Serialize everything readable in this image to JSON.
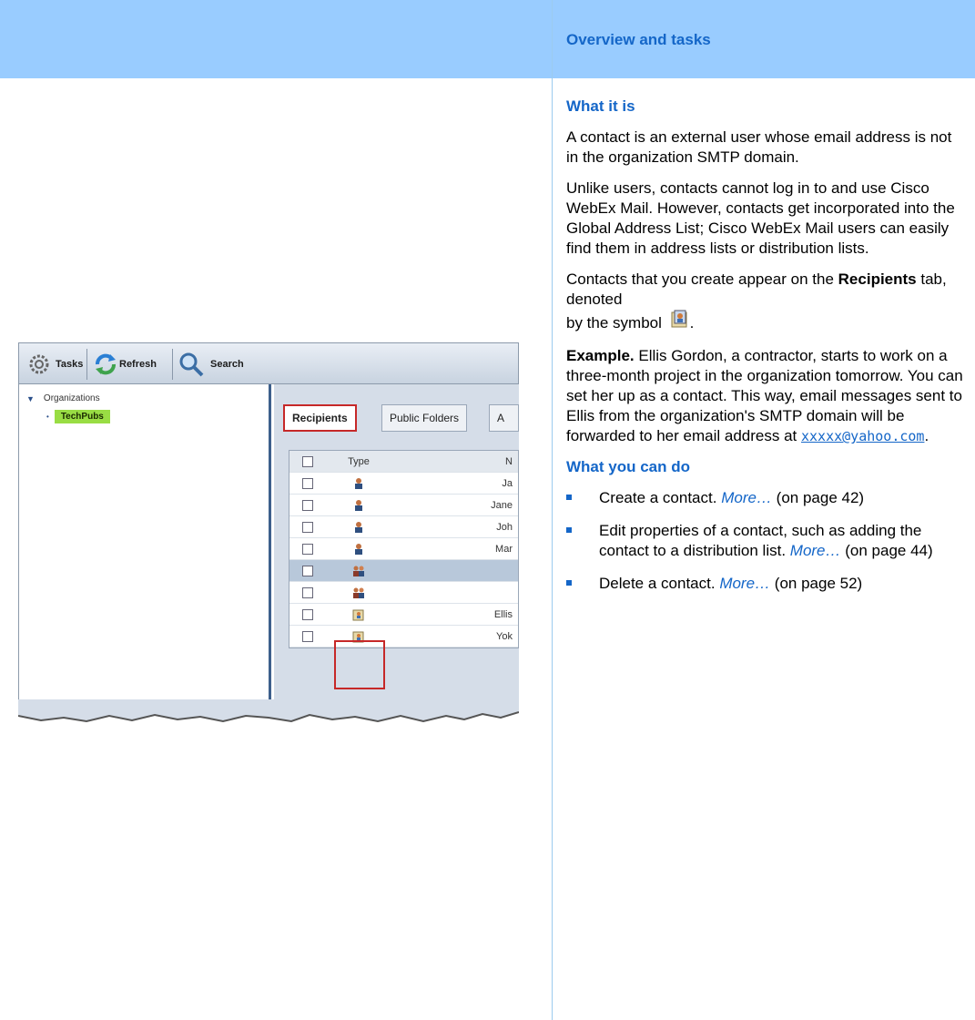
{
  "header": {
    "title": "Overview and tasks"
  },
  "what_it_is": {
    "heading": "What it is",
    "p1": "A contact is an external user whose email address is not in the organization SMTP domain.",
    "p2": "Unlike users, contacts cannot log in to and use Cisco WebEx Mail. However, contacts get incorporated into the Global Address List; Cisco WebEx Mail users can easily find them in address lists or distribution lists.",
    "p3_before": "Contacts that you create appear on the",
    "p3_bold": "Recipients",
    "p3_after": "tab, denoted",
    "p3_line2": "by the symbol",
    "example_label": "Example.",
    "example_text": "Ellis Gordon, a contractor, starts to work on a three-month project in the organization tomorrow. You can set her up as a contact. This way, email messages sent to Ellis from the organization's SMTP domain will be forwarded to her email address at",
    "email": "xxxxx@yahoo.com"
  },
  "what_you_can_do": {
    "heading": "What you can do",
    "items": [
      {
        "text": "Create a contact.",
        "more": "More…",
        "page": "(on page 42)"
      },
      {
        "text": "Edit properties of a contact, such as adding the contact to a distribution list.",
        "more": "More…",
        "page": "(on page 44)"
      },
      {
        "text": "Delete a contact.",
        "more": "More…",
        "page": "(on page 52)"
      }
    ]
  },
  "screenshot": {
    "toolbar": {
      "tasks": "Tasks",
      "refresh": "Refresh",
      "search": "Search"
    },
    "tree": {
      "root": "Organizations",
      "child": "TechPubs"
    },
    "tabs": [
      "Recipients",
      "Public Folders",
      "A"
    ],
    "table": {
      "col_type": "Type",
      "col_name": "N",
      "rows": [
        {
          "icon": "user-icon",
          "name": "Ja"
        },
        {
          "icon": "user-icon",
          "name": "Jane"
        },
        {
          "icon": "user-icon",
          "name": "Joh"
        },
        {
          "icon": "user-icon",
          "name": "Mar"
        },
        {
          "icon": "group-icon",
          "name": ""
        },
        {
          "icon": "group-icon",
          "name": ""
        },
        {
          "icon": "contact-icon",
          "name": "Ellis"
        },
        {
          "icon": "contact-icon",
          "name": "Yok"
        }
      ]
    }
  },
  "colors": {
    "accent": "#1466c8",
    "header_band": "#99ccff",
    "highlight_box": "#c62828"
  }
}
